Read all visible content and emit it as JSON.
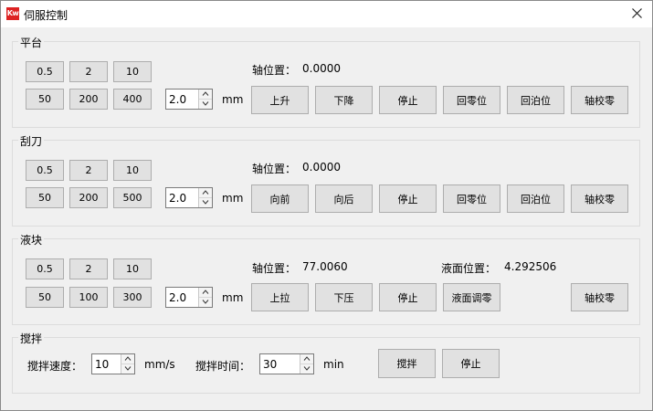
{
  "window": {
    "title": "伺服控制",
    "logo_text": "Kw",
    "close_icon": "close-icon"
  },
  "platform": {
    "label": "平台",
    "steps": [
      "0.5",
      "2",
      "10",
      "50",
      "200",
      "400"
    ],
    "distance": "2.0",
    "unit": "mm",
    "axis_label": "轴位置：",
    "axis_value": "0.0000",
    "actions": [
      "上升",
      "下降",
      "停止",
      "回零位",
      "回泊位",
      "轴校零"
    ]
  },
  "scraper": {
    "label": "刮刀",
    "steps": [
      "0.5",
      "2",
      "10",
      "50",
      "200",
      "500"
    ],
    "distance": "2.0",
    "unit": "mm",
    "axis_label": "轴位置：",
    "axis_value": "0.0000",
    "actions": [
      "向前",
      "向后",
      "停止",
      "回零位",
      "回泊位",
      "轴校零"
    ]
  },
  "tank": {
    "label": "液块",
    "steps": [
      "0.5",
      "2",
      "10",
      "50",
      "100",
      "300"
    ],
    "distance": "2.0",
    "unit": "mm",
    "axis_label": "轴位置：",
    "axis_value": "77.0060",
    "level_label": "液面位置：",
    "level_value": "4.292506",
    "actions": [
      "上拉",
      "下压",
      "停止",
      "液面调零",
      "轴校零"
    ]
  },
  "stir": {
    "label": "搅拌",
    "speed_label": "搅拌速度：",
    "speed_value": "10",
    "speed_unit": "mm/s",
    "time_label": "搅拌时间：",
    "time_value": "30",
    "time_unit": "min",
    "actions": [
      "搅拌",
      "停止"
    ]
  }
}
